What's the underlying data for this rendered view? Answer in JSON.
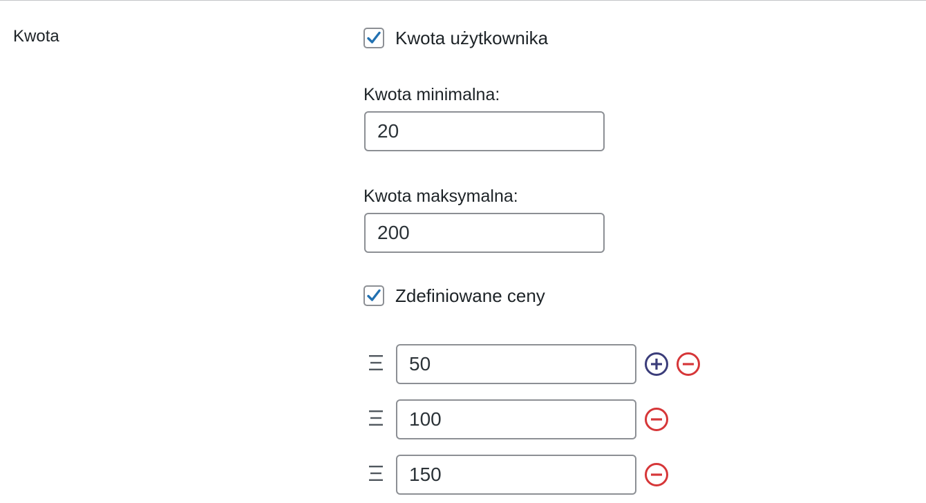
{
  "row": {
    "label": "Kwota"
  },
  "custom_amount": {
    "checkbox_label": "Kwota użytkownika",
    "checked": true
  },
  "min_amount": {
    "label": "Kwota minimalna:",
    "value": "20"
  },
  "max_amount": {
    "label": "Kwota maksymalna:",
    "value": "200"
  },
  "defined_prices": {
    "checkbox_label": "Zdefiniowane ceny",
    "checked": true,
    "items": [
      {
        "value": "50",
        "handle_icon": "drag-handle-icon",
        "add_icon": "plus-circle-icon",
        "remove_icon": "minus-circle-icon"
      },
      {
        "value": "100",
        "handle_icon": "drag-handle-icon",
        "remove_icon": "minus-circle-icon"
      },
      {
        "value": "150",
        "handle_icon": "drag-handle-icon",
        "remove_icon": "minus-circle-icon"
      }
    ]
  },
  "colors": {
    "check_blue": "#2271b1",
    "add_purple": "#3b3d7a",
    "remove_red": "#d63638",
    "border_gray": "#8c8f94"
  }
}
